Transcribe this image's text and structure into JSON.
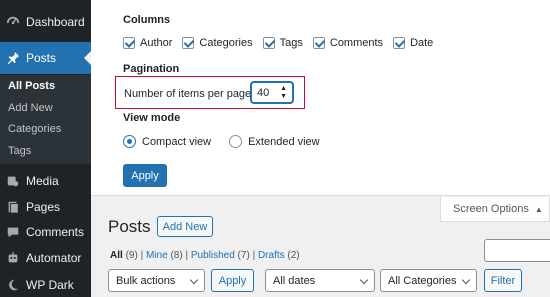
{
  "sidebar": {
    "items": [
      {
        "label": "Dashboard",
        "icon": "dashboard-icon"
      },
      {
        "label": "Posts",
        "icon": "pushpin-icon"
      },
      {
        "label": "Media",
        "icon": "media-icon"
      },
      {
        "label": "Pages",
        "icon": "pages-icon"
      },
      {
        "label": "Comments",
        "icon": "comments-icon"
      },
      {
        "label": "Automator",
        "icon": "robot-icon"
      },
      {
        "label": "WP Dark",
        "icon": "moon-icon"
      }
    ],
    "submenu": [
      "All Posts",
      "Add New",
      "Categories",
      "Tags"
    ]
  },
  "screen_options": {
    "columns_heading": "Columns",
    "columns": [
      "Author",
      "Categories",
      "Tags",
      "Comments",
      "Date"
    ],
    "pagination_heading": "Pagination",
    "per_page_label": "Number of items per page:",
    "per_page_value": "40",
    "view_mode_heading": "View mode",
    "view_modes": [
      "Compact view",
      "Extended view"
    ],
    "selected_view_mode": "Compact view",
    "apply_label": "Apply",
    "tab_label": "Screen Options"
  },
  "main": {
    "title": "Posts",
    "add_new_label": "Add New",
    "filters": {
      "all": "All",
      "all_count": "(9)",
      "mine": "Mine",
      "mine_count": "(8)",
      "published": "Published",
      "published_count": "(7)",
      "drafts": "Drafts",
      "drafts_count": "(2)",
      "separator": "|"
    },
    "bulk_actions": "Bulk actions",
    "apply_label": "Apply",
    "dates": "All dates",
    "categories": "All Categories",
    "filter_label": "Filter"
  },
  "colors": {
    "sidebar_bg": "#1d2327",
    "accent": "#2271b1",
    "highlight_border": "#c8102e"
  }
}
